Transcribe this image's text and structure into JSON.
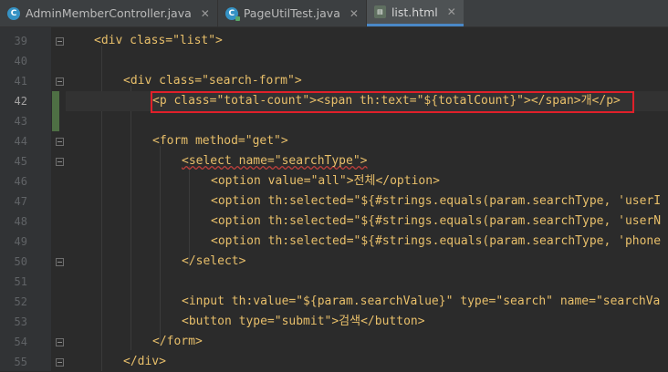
{
  "tabs": [
    {
      "label": "AdminMemberController.java",
      "icon": "java-class-icon",
      "active": false
    },
    {
      "label": "PageUtilTest.java",
      "icon": "java-test-class-icon",
      "active": false
    },
    {
      "label": "list.html",
      "icon": "html-file-icon",
      "active": true
    }
  ],
  "close_glyph": "✕",
  "current_line": 42,
  "lines": [
    {
      "n": "39"
    },
    {
      "n": "40"
    },
    {
      "n": "41"
    },
    {
      "n": "42"
    },
    {
      "n": "43"
    },
    {
      "n": "44"
    },
    {
      "n": "45"
    },
    {
      "n": "46"
    },
    {
      "n": "47"
    },
    {
      "n": "48"
    },
    {
      "n": "49"
    },
    {
      "n": "50"
    },
    {
      "n": "51"
    },
    {
      "n": "52"
    },
    {
      "n": "53"
    },
    {
      "n": "54"
    },
    {
      "n": "55"
    }
  ],
  "code": {
    "l39": "<div class=\"list\">",
    "l41": "<div class=\"search-form\">",
    "l42": "<p class=\"total-count\"><span th:text=\"${totalCount}\"></span>개</p>",
    "l44": "<form method=\"get\">",
    "l45": "<select name=\"searchType\">",
    "l46": "<option value=\"all\">전체</option>",
    "l47": "<option th:selected=\"${#strings.equals(param.searchType, 'userI",
    "l48": "<option th:selected=\"${#strings.equals(param.searchType, 'userN",
    "l49": "<option th:selected=\"${#strings.equals(param.searchType, 'phone",
    "l50": "</select>",
    "l52": "<input th:value=\"${param.searchValue}\" type=\"search\" name=\"searchVa",
    "l53": "<button type=\"submit\">검색</button>",
    "l54": "</form>",
    "l55": "</div>"
  },
  "colors": {
    "background": "#2b2b2b",
    "tag": "#e8bf6a",
    "attribute": "#bababa",
    "string": "#a5c25c",
    "highlight_box": "#e0202a",
    "active_tab_underline": "#4a88c7"
  }
}
